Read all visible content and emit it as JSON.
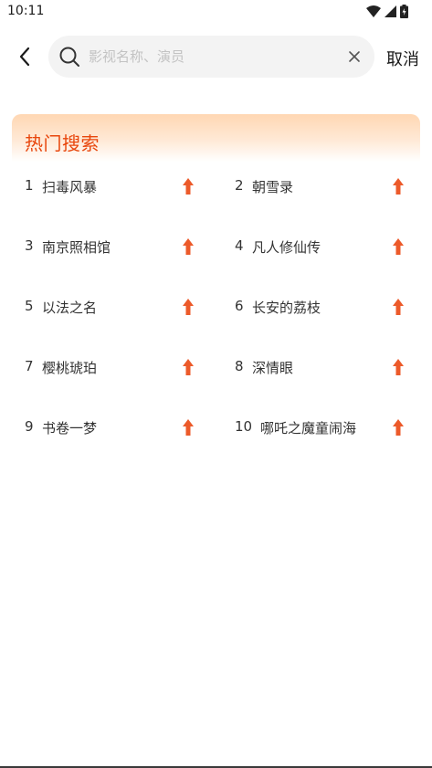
{
  "status_bar": {
    "time": "10:11"
  },
  "search": {
    "placeholder": "影视名称、演员",
    "value": "",
    "cancel_label": "取消"
  },
  "hot_search": {
    "title": "热门搜索",
    "trend_color": "#ec5a2a",
    "items": [
      {
        "rank": "1",
        "name": "扫毒风暴"
      },
      {
        "rank": "2",
        "name": "朝雪录"
      },
      {
        "rank": "3",
        "name": "南京照相馆"
      },
      {
        "rank": "4",
        "name": "凡人修仙传"
      },
      {
        "rank": "5",
        "name": "以法之名"
      },
      {
        "rank": "6",
        "name": "长安的荔枝"
      },
      {
        "rank": "7",
        "name": "樱桃琥珀"
      },
      {
        "rank": "8",
        "name": "深情眼"
      },
      {
        "rank": "9",
        "name": "书卷一梦"
      },
      {
        "rank": "10",
        "name": "哪吒之魔童闹海"
      }
    ]
  },
  "colors": {
    "accent": "#e8460c",
    "panel_gradient_top": "#ffd7b3",
    "search_bg": "#f3f3f3"
  }
}
